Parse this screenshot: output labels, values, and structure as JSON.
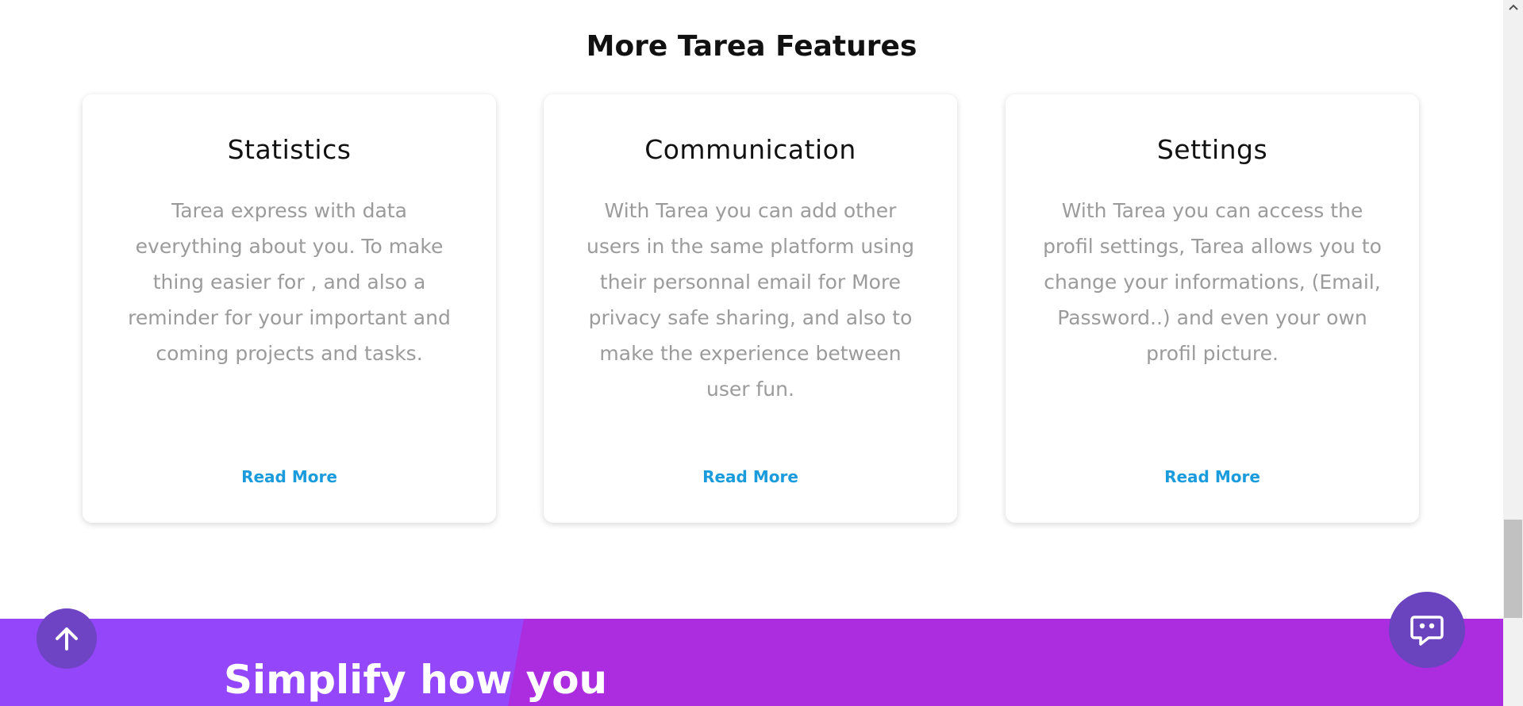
{
  "features": {
    "title": "More Tarea Features",
    "cards": [
      {
        "title": "Statistics",
        "description": "Tarea express with data everything about you. To make thing easier for , and also a reminder for your important and coming projects and tasks.",
        "link": "Read More"
      },
      {
        "title": "Communication",
        "description": "With Tarea you can add other users in the same platform using their personnal email for More privacy safe sharing, and also to make the experience between user fun.",
        "link": "Read More"
      },
      {
        "title": "Settings",
        "description": "With Tarea you can access the profil settings, Tarea allows you to change your informations, (Email, Password..) and even your own profil picture.",
        "link": "Read More"
      }
    ]
  },
  "banner": {
    "heading": "Simplify how you"
  },
  "floating": {
    "scroll_top_icon": "arrow-up-icon",
    "chat_icon": "chat-bubble-icon"
  },
  "colors": {
    "link": "#1a9bdc",
    "banner_left": "#9446fa",
    "banner_right": "#ac2ce0",
    "floating_button": "#6e44c4"
  }
}
